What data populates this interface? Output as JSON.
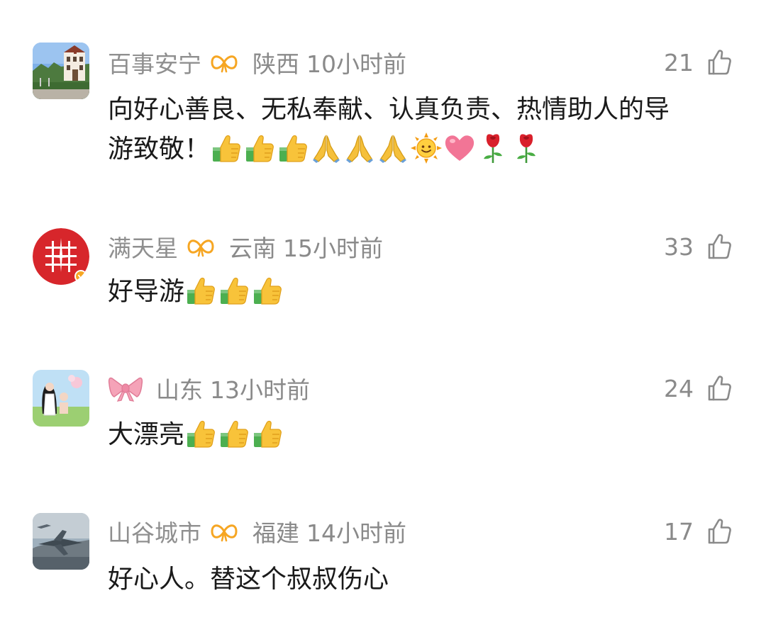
{
  "comments": [
    {
      "username": "百事安宁",
      "location": "陕西",
      "time": "10小时前",
      "likes": "21",
      "text_line1": "向好心善良、无私奉献、认真负责、热情助人的导",
      "text_line2": "游致敬！",
      "emojis": [
        "thumbs-up",
        "thumbs-up",
        "thumbs-up",
        "folded-hands",
        "folded-hands",
        "folded-hands",
        "sun-with-face",
        "heart",
        "rose",
        "rose"
      ]
    },
    {
      "username": "满天星",
      "location": "云南",
      "time": "15小时前",
      "likes": "33",
      "text": "好导游",
      "emojis": [
        "thumbs-up",
        "thumbs-up",
        "thumbs-up"
      ]
    },
    {
      "username": "",
      "location": "山东",
      "time": "13小时前",
      "likes": "24",
      "text": "大漂亮",
      "emojis": [
        "thumbs-up",
        "thumbs-up",
        "thumbs-up"
      ]
    },
    {
      "username": "山谷城市",
      "location": "福建",
      "time": "14小时前",
      "likes": "17",
      "text": "好心人。替这个叔叔伤心",
      "emojis": []
    }
  ],
  "colors": {
    "meta_gray": "#8a8a8a",
    "text_dark": "#1a1a1a",
    "badge_orange": "#f6a623"
  },
  "icons": {
    "like": "thumbs-up-outline-icon",
    "member_badge": "infinity-badge-icon",
    "bow_badge": "pink-bow-icon"
  }
}
